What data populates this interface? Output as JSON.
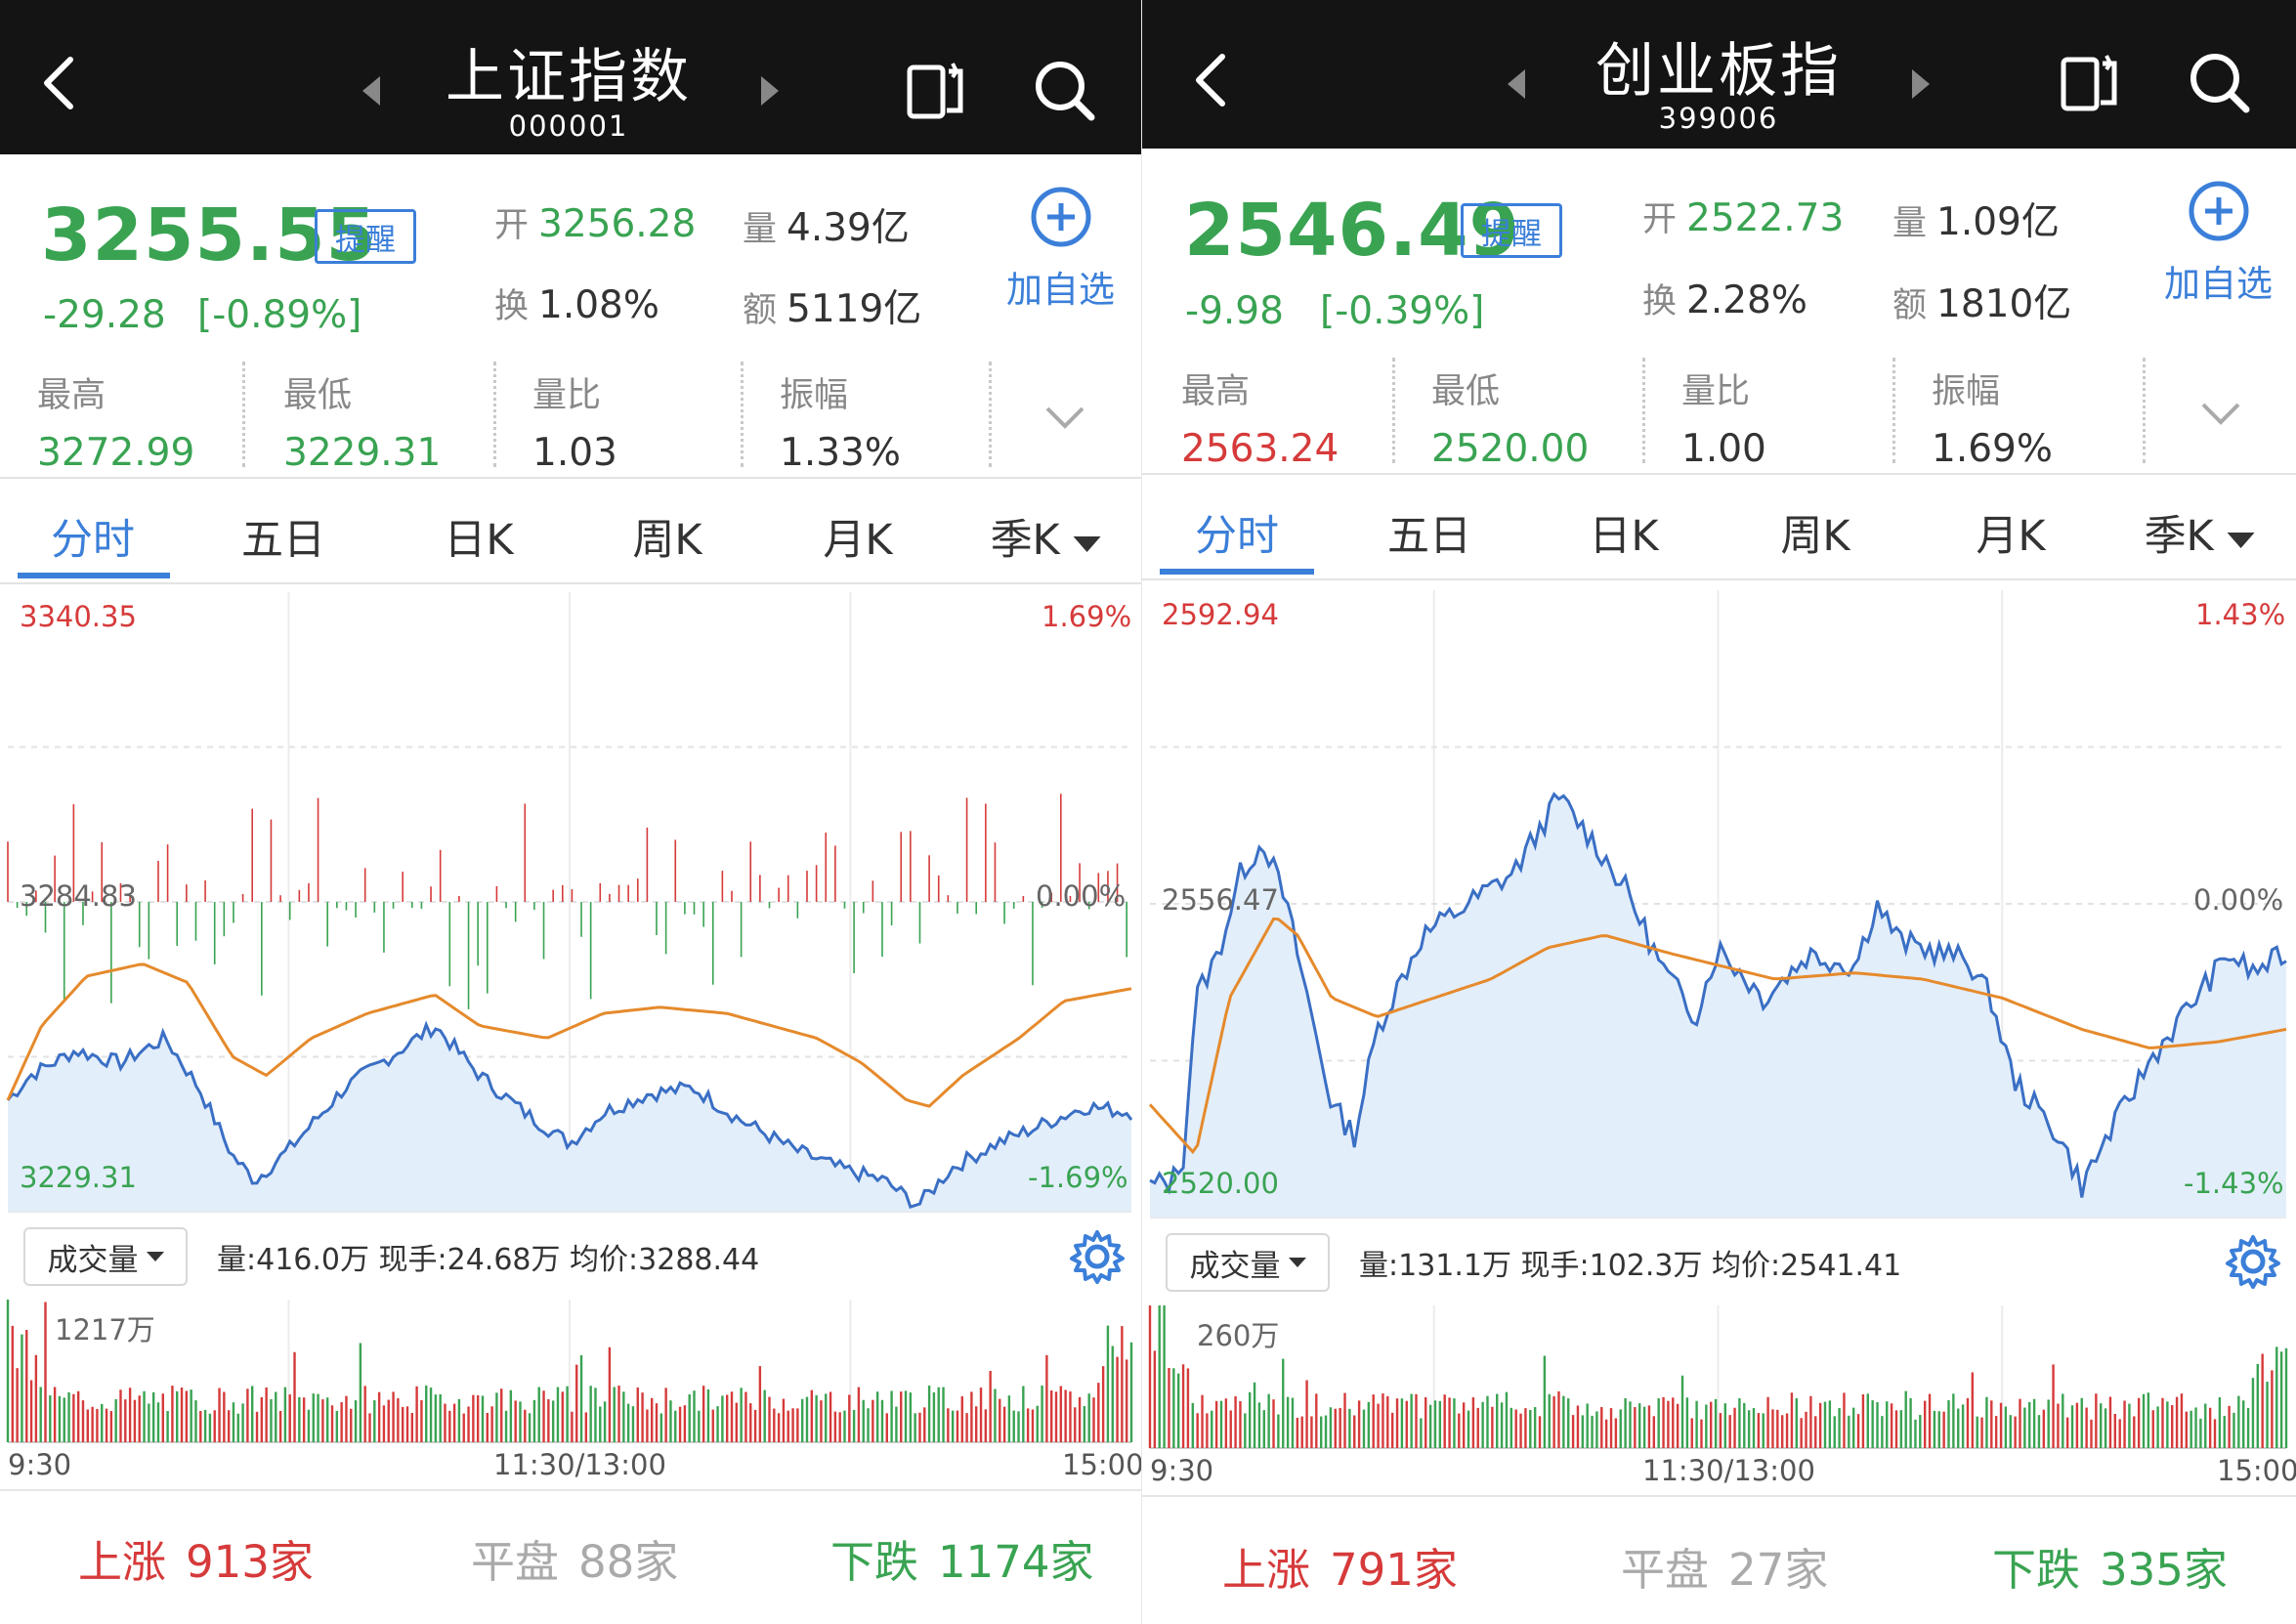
{
  "colors": {
    "up": "#d63a3a",
    "down": "#39a352",
    "accent": "#3b7fd9",
    "avg": "#e58a2c",
    "price": "#3a6fc4"
  },
  "panels": [
    {
      "header": {
        "title": "上证指数",
        "code": "000001"
      },
      "quote": {
        "price": "3255.55",
        "change": "-29.28",
        "change_pct": "[-0.89%]",
        "remind_label": "提醒",
        "open_key": "开",
        "open": "3256.28",
        "vol_key": "量",
        "vol": "4.39亿",
        "turnover_key": "换",
        "turnover": "1.08%",
        "amount_key": "额",
        "amount": "5119亿",
        "add_label": "加自选"
      },
      "stats": [
        {
          "label": "最高",
          "value": "3272.99",
          "color": "grn"
        },
        {
          "label": "最低",
          "value": "3229.31",
          "color": "grn"
        },
        {
          "label": "量比",
          "value": "1.03",
          "color": "dk"
        },
        {
          "label": "振幅",
          "value": "1.33%",
          "color": "dk"
        }
      ],
      "tabs": [
        "分时",
        "五日",
        "日K",
        "周K",
        "月K",
        "季K"
      ],
      "axis": {
        "high": "3340.35",
        "low": "3229.31",
        "mid": "3284.83",
        "pct_high": "1.69%",
        "pct_low": "-1.69%",
        "pct_mid": "0.00%"
      },
      "volume_bar": {
        "button": "成交量",
        "info": "量:416.0万  现手:24.68万  均价:3288.44",
        "max": "1217万"
      },
      "times": {
        "start": "9:30",
        "mid": "11:30/13:00",
        "end": "15:00"
      },
      "breadth": {
        "up_label": "上涨",
        "up": "913家",
        "flat_label": "平盘",
        "flat": "88家",
        "down_label": "下跌",
        "down": "1174家"
      }
    },
    {
      "header": {
        "title": "创业板指",
        "code": "399006"
      },
      "quote": {
        "price": "2546.49",
        "change": "-9.98",
        "change_pct": "[-0.39%]",
        "remind_label": "提醒",
        "open_key": "开",
        "open": "2522.73",
        "vol_key": "量",
        "vol": "1.09亿",
        "turnover_key": "换",
        "turnover": "2.28%",
        "amount_key": "额",
        "amount": "1810亿",
        "add_label": "加自选"
      },
      "stats": [
        {
          "label": "最高",
          "value": "2563.24",
          "color": "red"
        },
        {
          "label": "最低",
          "value": "2520.00",
          "color": "grn"
        },
        {
          "label": "量比",
          "value": "1.00",
          "color": "dk"
        },
        {
          "label": "振幅",
          "value": "1.69%",
          "color": "dk"
        }
      ],
      "tabs": [
        "分时",
        "五日",
        "日K",
        "周K",
        "月K",
        "季K"
      ],
      "axis": {
        "high": "2592.94",
        "low": "2520.00",
        "mid": "2556.47",
        "pct_high": "1.43%",
        "pct_low": "-1.43%",
        "pct_mid": "0.00%"
      },
      "volume_bar": {
        "button": "成交量",
        "info": "量:131.1万  现手:102.3万  均价:2541.41",
        "max": "260万"
      },
      "times": {
        "start": "9:30",
        "mid": "11:30/13:00",
        "end": "15:00"
      },
      "breadth": {
        "up_label": "上涨",
        "up": "791家",
        "flat_label": "平盘",
        "flat": "27家",
        "down_label": "下跌",
        "down": "335家"
      }
    }
  ]
}
